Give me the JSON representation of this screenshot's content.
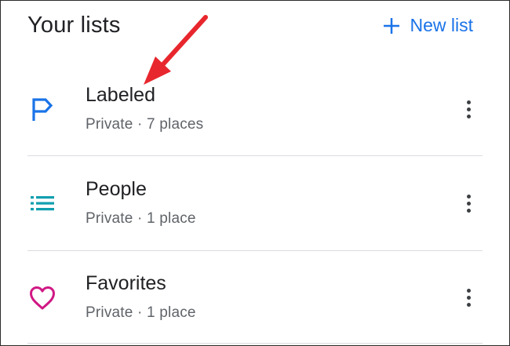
{
  "header": {
    "title": "Your lists",
    "new_list_label": "New list"
  },
  "lists": [
    {
      "name": "Labeled",
      "meta": "Private · 7 places",
      "icon": "flag-icon",
      "icon_color": "#1a73e8"
    },
    {
      "name": "People",
      "meta": "Private · 1 place",
      "icon": "list-icon",
      "icon_color": "#129eaf"
    },
    {
      "name": "Favorites",
      "meta": "Private · 1 place",
      "icon": "heart-icon",
      "icon_color": "#d01884"
    }
  ],
  "colors": {
    "accent": "#1a73e8",
    "annotation_arrow": "#e8262d"
  }
}
